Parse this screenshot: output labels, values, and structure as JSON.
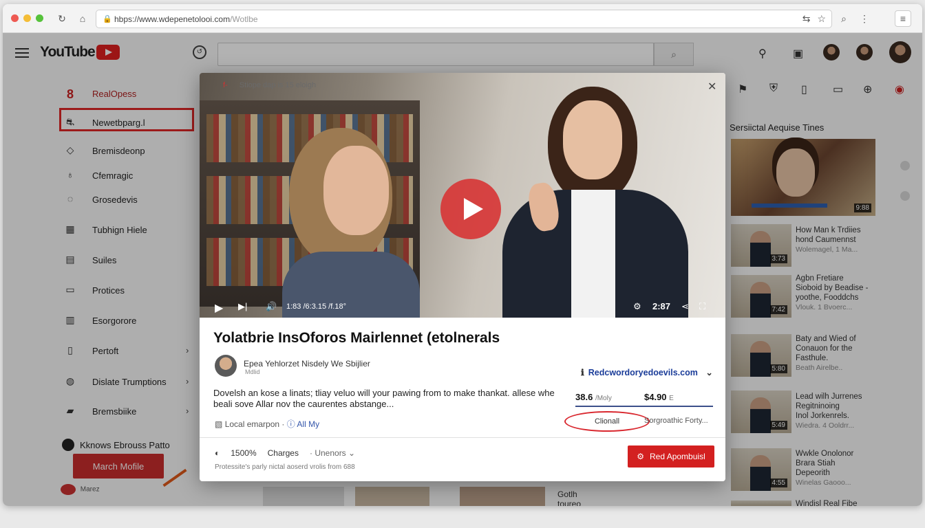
{
  "browser": {
    "url": "https://www.wdepenetolooi.com/Wotlbe",
    "url_dim": "/Wotlbe",
    "url_main": "hbps://www.wdepenetolooi.com"
  },
  "header": {
    "logo": "YouTube"
  },
  "sidebar": {
    "items": [
      {
        "label": "RealOpess",
        "icon": "8"
      },
      {
        "label": "Newetbparg.l",
        "icon": "⛐"
      },
      {
        "label": "Bremisdeonp",
        "icon": "◇"
      },
      {
        "label": "Cfemragic",
        "icon": "♁"
      },
      {
        "label": "Grosedevis",
        "icon": "◌"
      },
      {
        "label": "Tubhign Hiele",
        "icon": "▦"
      },
      {
        "label": "Suiles",
        "icon": "▤"
      },
      {
        "label": "Protices",
        "icon": "▭"
      },
      {
        "label": "Esorgorore",
        "icon": "▥"
      },
      {
        "label": "Pertoft",
        "icon": "▯"
      },
      {
        "label": "Dislate Trumptions",
        "icon": "◍"
      },
      {
        "label": "Bremsbiike",
        "icon": "▰"
      }
    ],
    "footer_label": "Kknows Ebrouss Patto",
    "button_label": "March Mofile",
    "bottom_label": "Marez"
  },
  "modal": {
    "top_text": "Stiope dap is 15 eloigh",
    "top_red": "f-",
    "controls": {
      "time": "1:83 /6:3.15 /f.18°",
      "right_time": "2:87"
    },
    "title": "Yolatbrie InsOforos Mairlennet (etolnerals",
    "channel_name": "Epea Yehlorzet Nisdely We Sbijlier",
    "channel_sub": "Mdlid",
    "channel_link": "Redcwordoryedoevils.com",
    "description": "Dovelsh an kose a linats; tliay veluo will your pawing from to make thankat. allese whe beali sove Allar nov the caurentes abstange...",
    "stat1_value": "38.6",
    "stat1_unit": "/Moly",
    "stat2_value": "$4.90",
    "stat2_unit": "E",
    "location": "Local emarpon",
    "location_link": "ⓘ All My",
    "pill_label": "Clionall",
    "pill2_label": "Sorgroathic Forty...",
    "bottom": {
      "percent": "1500%",
      "charges": "Charges",
      "users": "Unenors"
    },
    "note": "Protessite's parly nictal aoserd vrolis from 688",
    "red_button": "Red Apombuisl"
  },
  "right_column": {
    "title": "Sersiictal Aequise Tines",
    "big_duration": "9:88",
    "items": [
      {
        "line1": "How Man k Trdiies",
        "line2": "hond Caumennst",
        "meta": "Wolemagel, 1 Ma...",
        "duration": "3:73"
      },
      {
        "line1": "Agbn Fretiare",
        "line2": "Sioboid by Beadise -",
        "line3": "yoothe, Fooddchs",
        "meta": "Vlouk. 1 Bvoerc...",
        "duration": "7:42"
      },
      {
        "line1": "Baty and Wied of",
        "line2": "Conauon for the",
        "line3": "Fasthule.",
        "meta": "Beath Airelbe..",
        "duration": "5:80"
      },
      {
        "line1": "Lead wilh Jurrenes",
        "line2": "Regitninoing",
        "line3": "Inol Jorkenrels.",
        "meta": "Wiedra. 4 Ooldrr...",
        "duration": "5:49"
      },
      {
        "line1": "Wwkle Onolonor",
        "line2": "Brara Stiah",
        "line3": "Depeorith",
        "meta": "Winelas Gaooo...",
        "duration": "4:55"
      },
      {
        "line1": "Windisl Real Fibe",
        "line2": "",
        "meta": "",
        "duration": ""
      }
    ]
  },
  "bottom_strip": {
    "text1": "Gotlh",
    "text2": "toureo"
  }
}
